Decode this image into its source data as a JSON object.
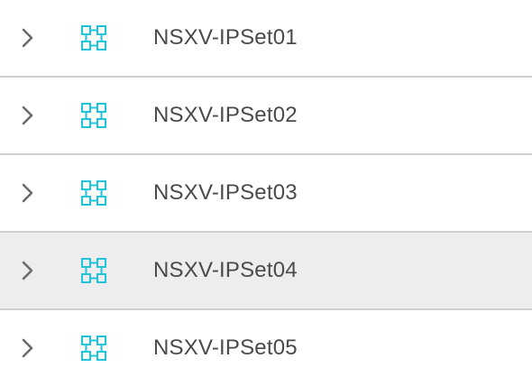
{
  "ipset_list": {
    "rows": [
      {
        "label": "NSXV-IPSet01",
        "highlighted": false,
        "icon": "chevron-right-icon",
        "type_icon": "ipset-group-icon"
      },
      {
        "label": "NSXV-IPSet02",
        "highlighted": false,
        "icon": "chevron-right-icon",
        "type_icon": "ipset-group-icon"
      },
      {
        "label": "NSXV-IPSet03",
        "highlighted": false,
        "icon": "chevron-right-icon",
        "type_icon": "ipset-group-icon"
      },
      {
        "label": "NSXV-IPSet04",
        "highlighted": true,
        "icon": "chevron-right-icon",
        "type_icon": "ipset-group-icon"
      },
      {
        "label": "NSXV-IPSet05",
        "highlighted": false,
        "icon": "chevron-right-icon",
        "type_icon": "ipset-group-icon"
      }
    ]
  },
  "colors": {
    "icon_accent": "#1ec3dc",
    "chevron": "#6b6b6b",
    "text": "#4a4a4a",
    "divider": "#cfcfcf",
    "highlight_bg": "#ededed"
  }
}
